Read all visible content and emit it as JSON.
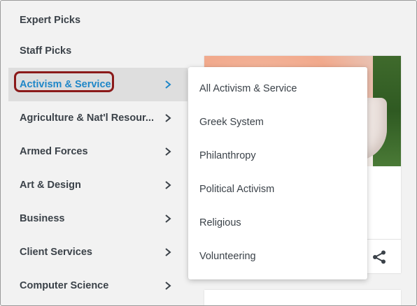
{
  "categories": [
    {
      "label": "Expert Picks",
      "has_submenu": false
    },
    {
      "label": "Staff Picks",
      "has_submenu": false
    },
    {
      "label": "Activism & Service",
      "has_submenu": true,
      "active": true
    },
    {
      "label": "Agriculture & Nat'l Resour...",
      "has_submenu": true
    },
    {
      "label": "Armed Forces",
      "has_submenu": true
    },
    {
      "label": "Art & Design",
      "has_submenu": true
    },
    {
      "label": "Business",
      "has_submenu": true
    },
    {
      "label": "Client Services",
      "has_submenu": true
    },
    {
      "label": "Computer Science",
      "has_submenu": true
    }
  ],
  "submenu": {
    "items": [
      {
        "label": "All Activism & Service"
      },
      {
        "label": "Greek System"
      },
      {
        "label": "Philanthropy"
      },
      {
        "label": "Political Activism"
      },
      {
        "label": "Religious"
      },
      {
        "label": "Volunteering"
      }
    ]
  },
  "card": {
    "share_icon": "share-icon"
  },
  "colors": {
    "active_text": "#1f87c8",
    "highlight_border": "#8b1a1a",
    "text": "#3b4249",
    "background": "#f2f2f2"
  }
}
